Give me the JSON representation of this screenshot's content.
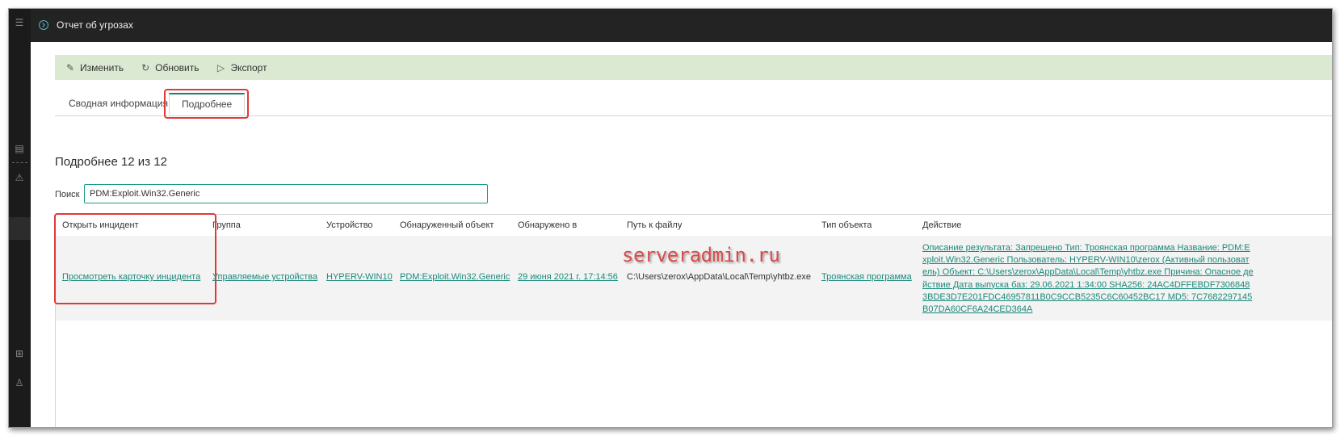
{
  "window": {
    "title": "Отчет об угрозах"
  },
  "toolbar": {
    "edit_label": "Изменить",
    "refresh_label": "Обновить",
    "export_label": "Экспорт"
  },
  "tabs": [
    {
      "label": "Сводная информация",
      "active": false
    },
    {
      "label": "Подробнее",
      "active": true
    }
  ],
  "details": {
    "title": "Подробнее 12 из 12",
    "search_label": "Поиск",
    "search_value": "PDM:Exploit.Win32.Generic"
  },
  "table": {
    "columns": [
      "Открыть инцидент",
      "Группа",
      "Устройство",
      "Обнаруженный объект",
      "Обнаружено в",
      "Путь к файлу",
      "Тип объекта",
      "Действие"
    ],
    "rows": [
      {
        "open_incident": "Просмотреть карточку инцидента",
        "group": "Управляемые устройства",
        "device": "HYPERV-WIN10",
        "object": "PDM:Exploit.Win32.Generic",
        "detected_at": "29 июня 2021 г. 17:14:56",
        "path": "C:\\Users\\zerox\\AppData\\Local\\Temp\\yhtbz.exe",
        "object_type": "Троянская программа",
        "action": "Описание результата: Запрещено Тип: Троянская программа Название: PDM:Exploit.Win32.Generic Пользователь: HYPERV-WIN10\\zerox (Активный пользователь) Объект: C:\\Users\\zerox\\AppData\\Local\\Temp\\yhtbz.exe Причина: Опасное действие Дата выпуска баз: 29.06.2021 1:34:00 SHA256: 24AC4DFFEBDF73068483BDE3D7E201FDC46957811B0C9CCB5235C6C60452BC17 MD5: 7C7682297145B07DA60CF6A24CED364A"
      }
    ]
  },
  "watermark": "serveradmin.ru",
  "colors": {
    "accent": "#1a8a7a",
    "toolbar_bg": "#dbe9d3",
    "highlight": "#e0393a"
  }
}
